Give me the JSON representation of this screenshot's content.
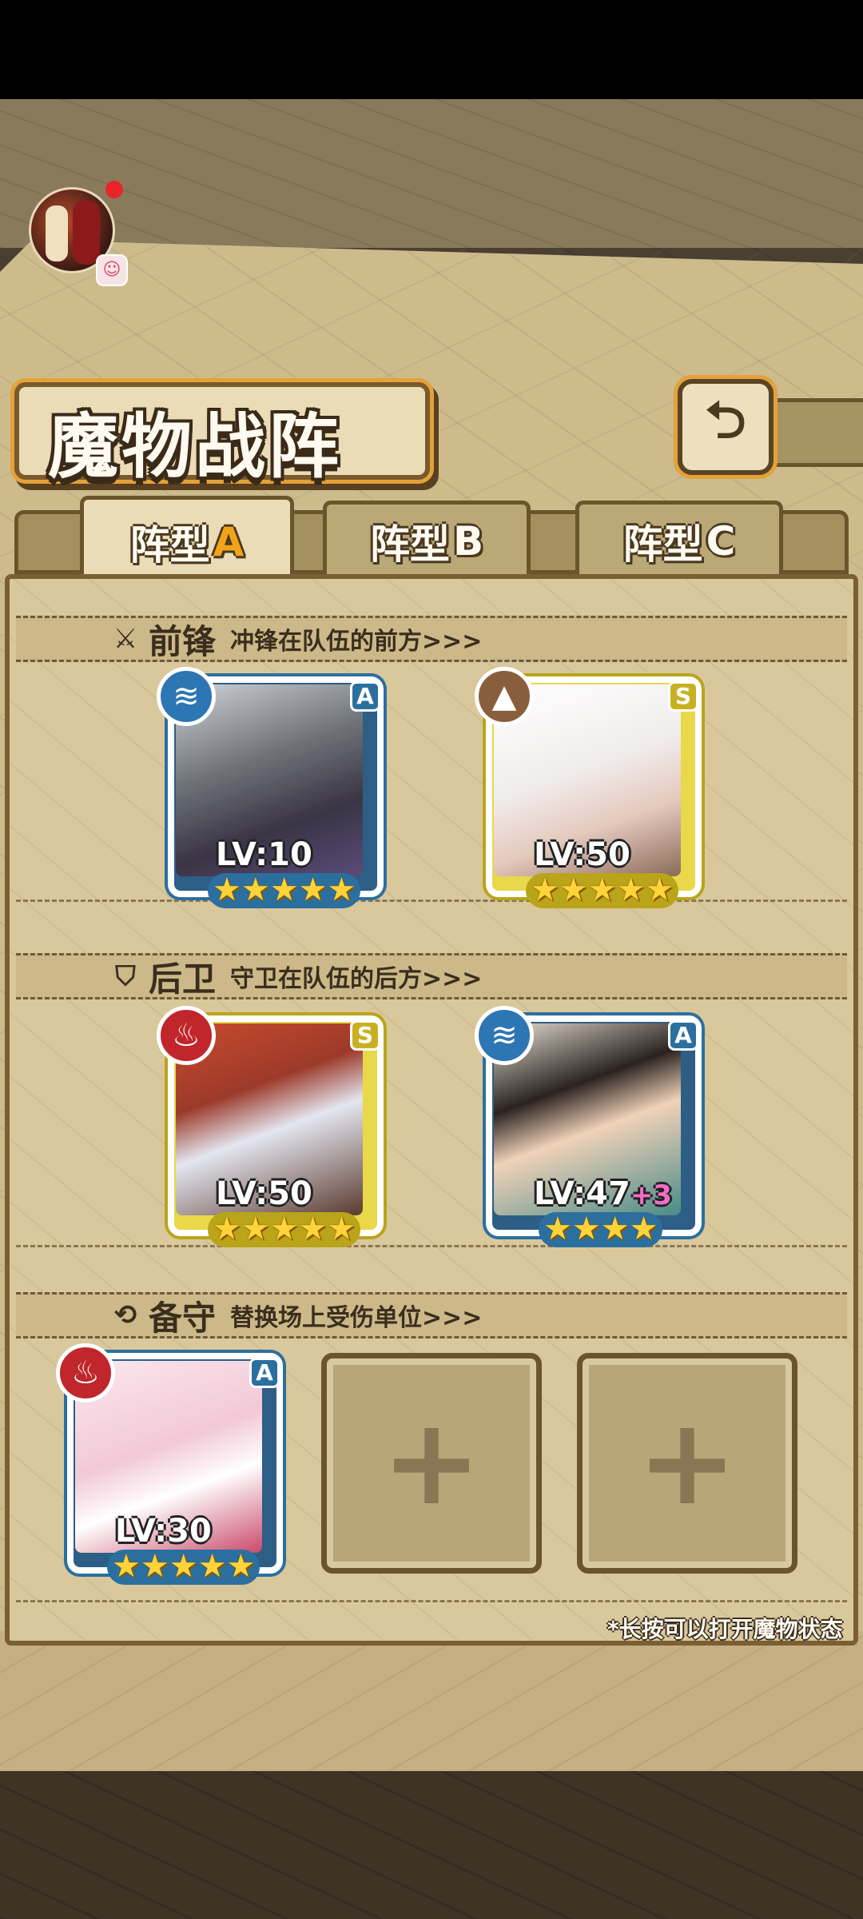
{
  "title": "魔物战阵",
  "back_icon": "back-arrow-icon",
  "tabs": [
    {
      "label": "阵型",
      "letter": "A",
      "active": true
    },
    {
      "label": "阵型",
      "letter": "B",
      "active": false
    },
    {
      "label": "阵型",
      "letter": "C",
      "active": false
    }
  ],
  "sections": {
    "front": {
      "name": "前锋",
      "desc": "冲锋在队伍的前方>>>",
      "icon": "sword-icon"
    },
    "rear": {
      "name": "后卫",
      "desc": "守卫在队伍的后方>>>",
      "icon": "shield-icon"
    },
    "reserve": {
      "name": "备守",
      "desc": "替换场上受伤单位>>>",
      "icon": "swap-icon"
    }
  },
  "units": {
    "front1": {
      "level": "LV:10",
      "rank": "A",
      "element": "water",
      "stars": 5
    },
    "front2": {
      "level": "LV:50",
      "rank": "S",
      "element": "earth",
      "stars": 5
    },
    "rear1": {
      "level": "LV:50",
      "rank": "S",
      "element": "fire",
      "stars": 5
    },
    "rear2": {
      "level": "LV:47",
      "plus": "+3",
      "rank": "A",
      "element": "water",
      "stars": 4
    },
    "reserve1": {
      "level": "LV:30",
      "rank": "A",
      "element": "fire",
      "stars": 5
    }
  },
  "empty_slot_symbol": "+",
  "hint": "*长按可以打开魔物状态",
  "colors": {
    "rank_a": "#2b6f9f",
    "rank_s": "#c9b022",
    "tab_letter": "#f2a418",
    "water": "#2d76b4",
    "fire": "#c0262b",
    "earth": "#8a5e3c"
  }
}
